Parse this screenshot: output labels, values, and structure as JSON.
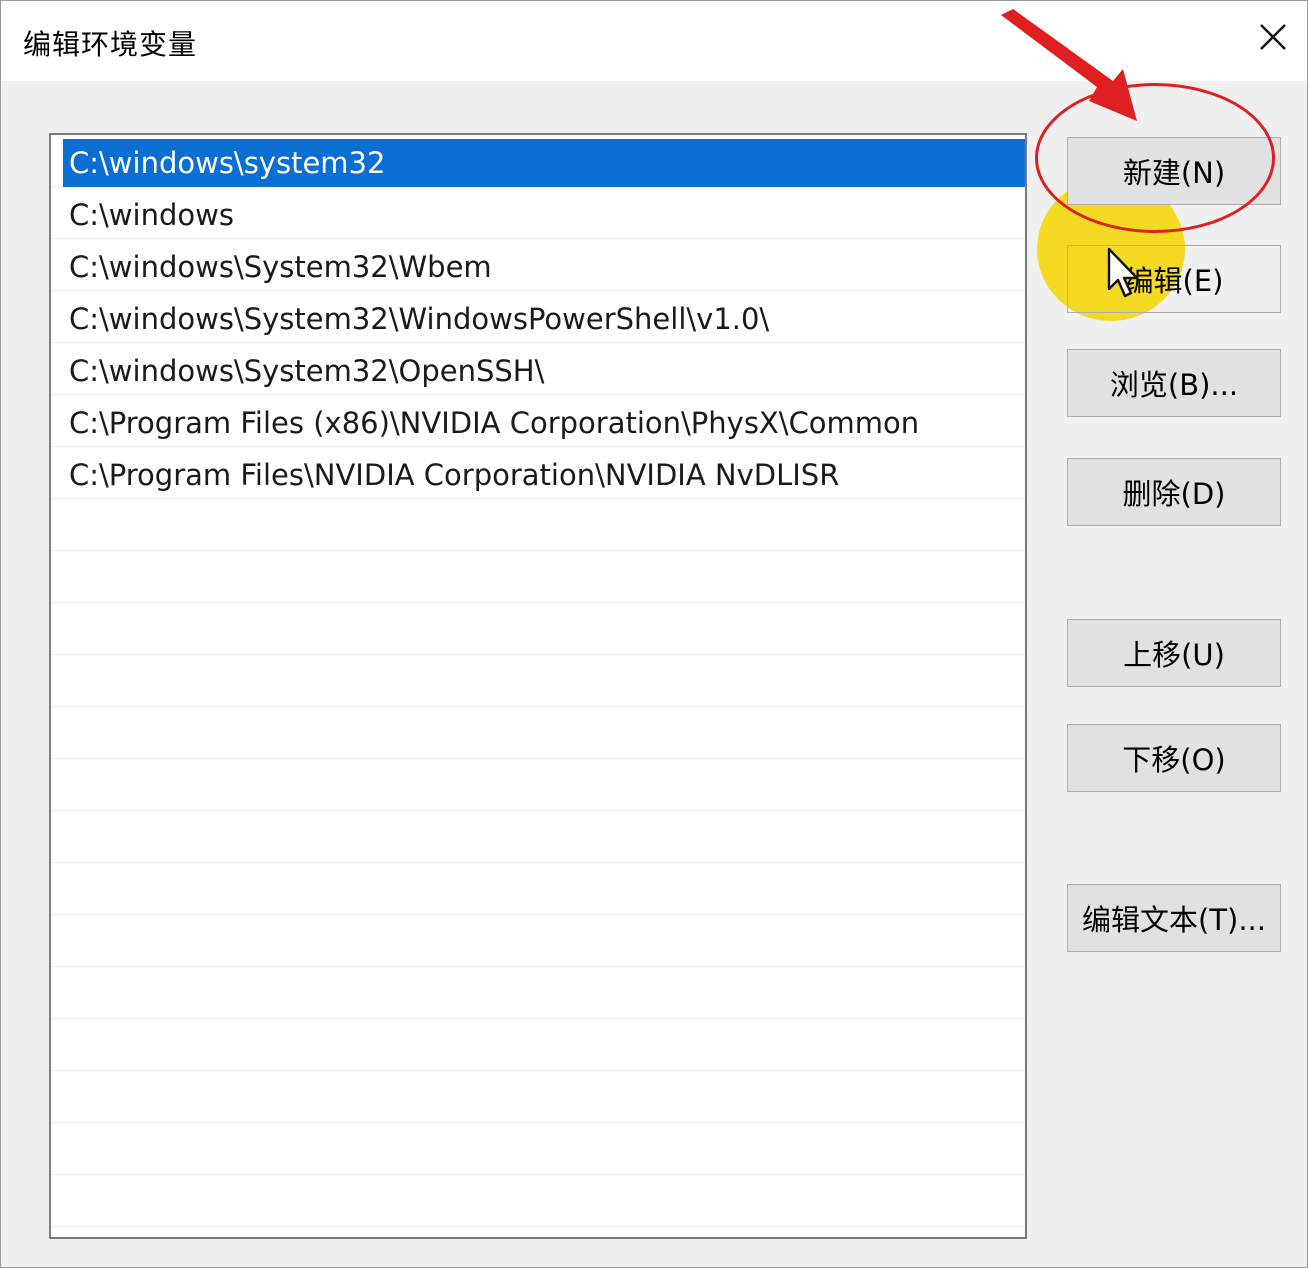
{
  "window": {
    "title": "编辑环境变量",
    "close_icon": "close-icon"
  },
  "list": {
    "items": [
      {
        "label": "C:\\windows\\system32",
        "selected": true
      },
      {
        "label": "C:\\windows",
        "selected": false
      },
      {
        "label": "C:\\windows\\System32\\Wbem",
        "selected": false
      },
      {
        "label": "C:\\windows\\System32\\WindowsPowerShell\\v1.0\\",
        "selected": false
      },
      {
        "label": "C:\\windows\\System32\\OpenSSH\\",
        "selected": false
      },
      {
        "label": "C:\\Program Files (x86)\\NVIDIA Corporation\\PhysX\\Common",
        "selected": false
      },
      {
        "label": "C:\\Program Files\\NVIDIA Corporation\\NVIDIA NvDLISR",
        "selected": false
      }
    ],
    "empty_rows": 14,
    "selection_color": "#0a6fd1"
  },
  "buttons": {
    "new": "新建(N)",
    "edit": "编辑(E)",
    "browse": "浏览(B)...",
    "delete": "删除(D)",
    "move_up": "上移(U)",
    "move_down": "下移(O)",
    "edit_text": "编辑文本(T)..."
  },
  "annotations": {
    "arrow_color": "#e02020",
    "circle_color": "#e02020",
    "highlight_color": "#f6d600",
    "cursor_icon": "mouse-pointer-icon"
  }
}
